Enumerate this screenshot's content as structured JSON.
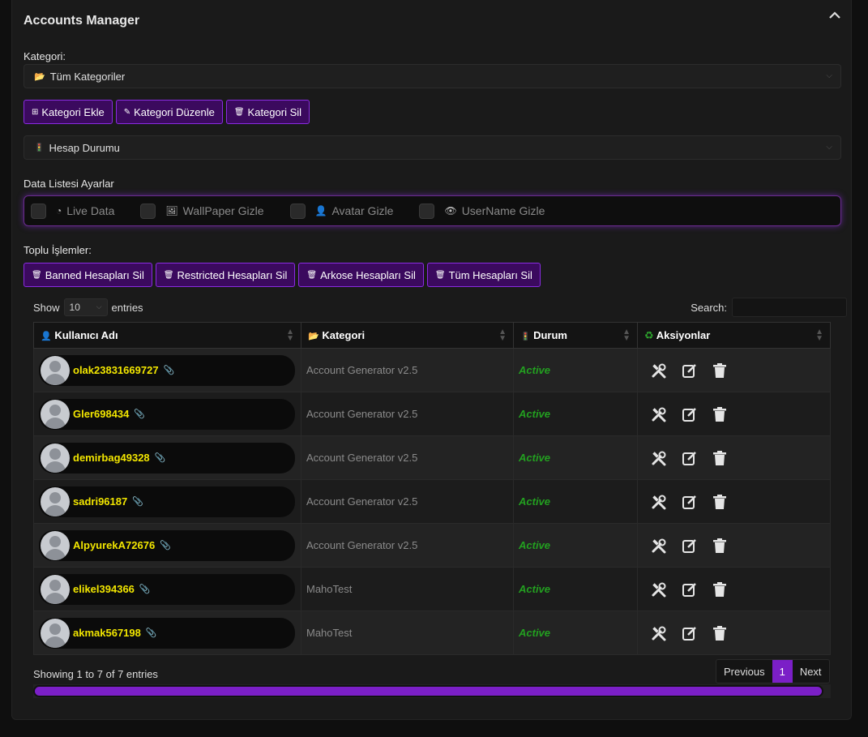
{
  "panel": {
    "title": "Accounts Manager"
  },
  "kategori": {
    "label": "Kategori:",
    "selected": "Tüm Kategoriler"
  },
  "category_buttons": [
    {
      "label": "Kategori Ekle",
      "icon": "plus-square-icon"
    },
    {
      "label": "Kategori Düzenle",
      "icon": "edit-icon"
    },
    {
      "label": "Kategori Sil",
      "icon": "trash-icon"
    }
  ],
  "status_filter": {
    "selected": "Hesap Durumu"
  },
  "data_settings": {
    "label": "Data Listesi Ayarlar",
    "toggles": [
      {
        "label": "Live Data",
        "icon": "pie-icon",
        "checked": false
      },
      {
        "label": "WallPaper Gizle",
        "icon": "picture-icon",
        "checked": false
      },
      {
        "label": "Avatar Gizle",
        "icon": "person-icon",
        "checked": false
      },
      {
        "label": "UserName Gizle",
        "icon": "eye-icon",
        "checked": false
      }
    ]
  },
  "bulk": {
    "label": "Toplu İşlemler:",
    "buttons": [
      {
        "label": "Banned Hesapları Sil"
      },
      {
        "label": "Restricted Hesapları Sil"
      },
      {
        "label": "Arkose Hesapları Sil"
      },
      {
        "label": "Tüm Hesapları Sil"
      }
    ]
  },
  "table_controls": {
    "show_label": "Show",
    "entries_value": "10",
    "entries_label": "entries",
    "search_label": "Search:"
  },
  "columns": [
    {
      "label": "Kullanıcı Adı",
      "icon": "user-icon"
    },
    {
      "label": "Kategori",
      "icon": "folder-icon"
    },
    {
      "label": "Durum",
      "icon": "traffic-light-icon"
    },
    {
      "label": "Aksiyonlar",
      "icon": "recycle-icon"
    }
  ],
  "rows": [
    {
      "username": "olak23831669727",
      "category": "Account Generator v2.5",
      "status": "Active"
    },
    {
      "username": "Gler698434",
      "category": "Account Generator v2.5",
      "status": "Active"
    },
    {
      "username": "demirbag49328",
      "category": "Account Generator v2.5",
      "status": "Active"
    },
    {
      "username": "sadri96187",
      "category": "Account Generator v2.5",
      "status": "Active"
    },
    {
      "username": "AlpyurekA72676",
      "category": "Account Generator v2.5",
      "status": "Active"
    },
    {
      "username": "elikel394366",
      "category": "MahoTest",
      "status": "Active"
    },
    {
      "username": "akmak567198",
      "category": "MahoTest",
      "status": "Active"
    }
  ],
  "footer": {
    "info": "Showing 1 to 7 of 7 entries",
    "previous": "Previous",
    "page": "1",
    "next": "Next"
  },
  "colors": {
    "accent": "#7b1fc7",
    "username": "#f2e600",
    "active": "#23a020"
  }
}
